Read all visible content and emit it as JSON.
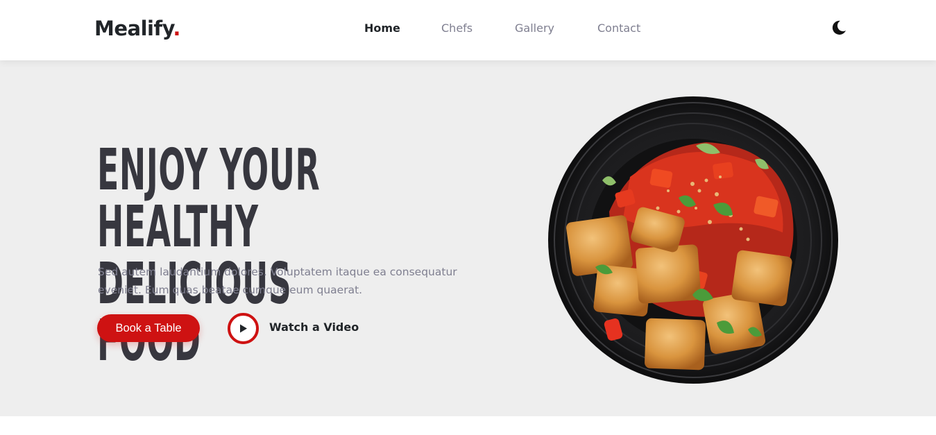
{
  "brand": {
    "name": "Mealify",
    "dot": "."
  },
  "nav": {
    "items": [
      {
        "label": "Home",
        "active": true
      },
      {
        "label": "Chefs",
        "active": false
      },
      {
        "label": "Gallery",
        "active": false
      },
      {
        "label": "Contact",
        "active": false
      }
    ],
    "theme_toggle_icon": "moon-icon"
  },
  "hero": {
    "title_line1": "Enjoy Your Healthy",
    "title_line2": "Delicious Food",
    "description": "Sed autem laudantium dolores. Voluptatem itaque ea consequatur eveniet. Eum quas beatae cumque eum quaerat.",
    "book_button": "Book a Table",
    "watch_video": "Watch a Video",
    "play_icon": "play-icon",
    "image": "food-plate-image"
  },
  "colors": {
    "accent": "#ce1212",
    "hero_bg": "#eeeeee",
    "heading": "#37373f",
    "text_muted": "#7f7f90",
    "dark": "#212529"
  }
}
